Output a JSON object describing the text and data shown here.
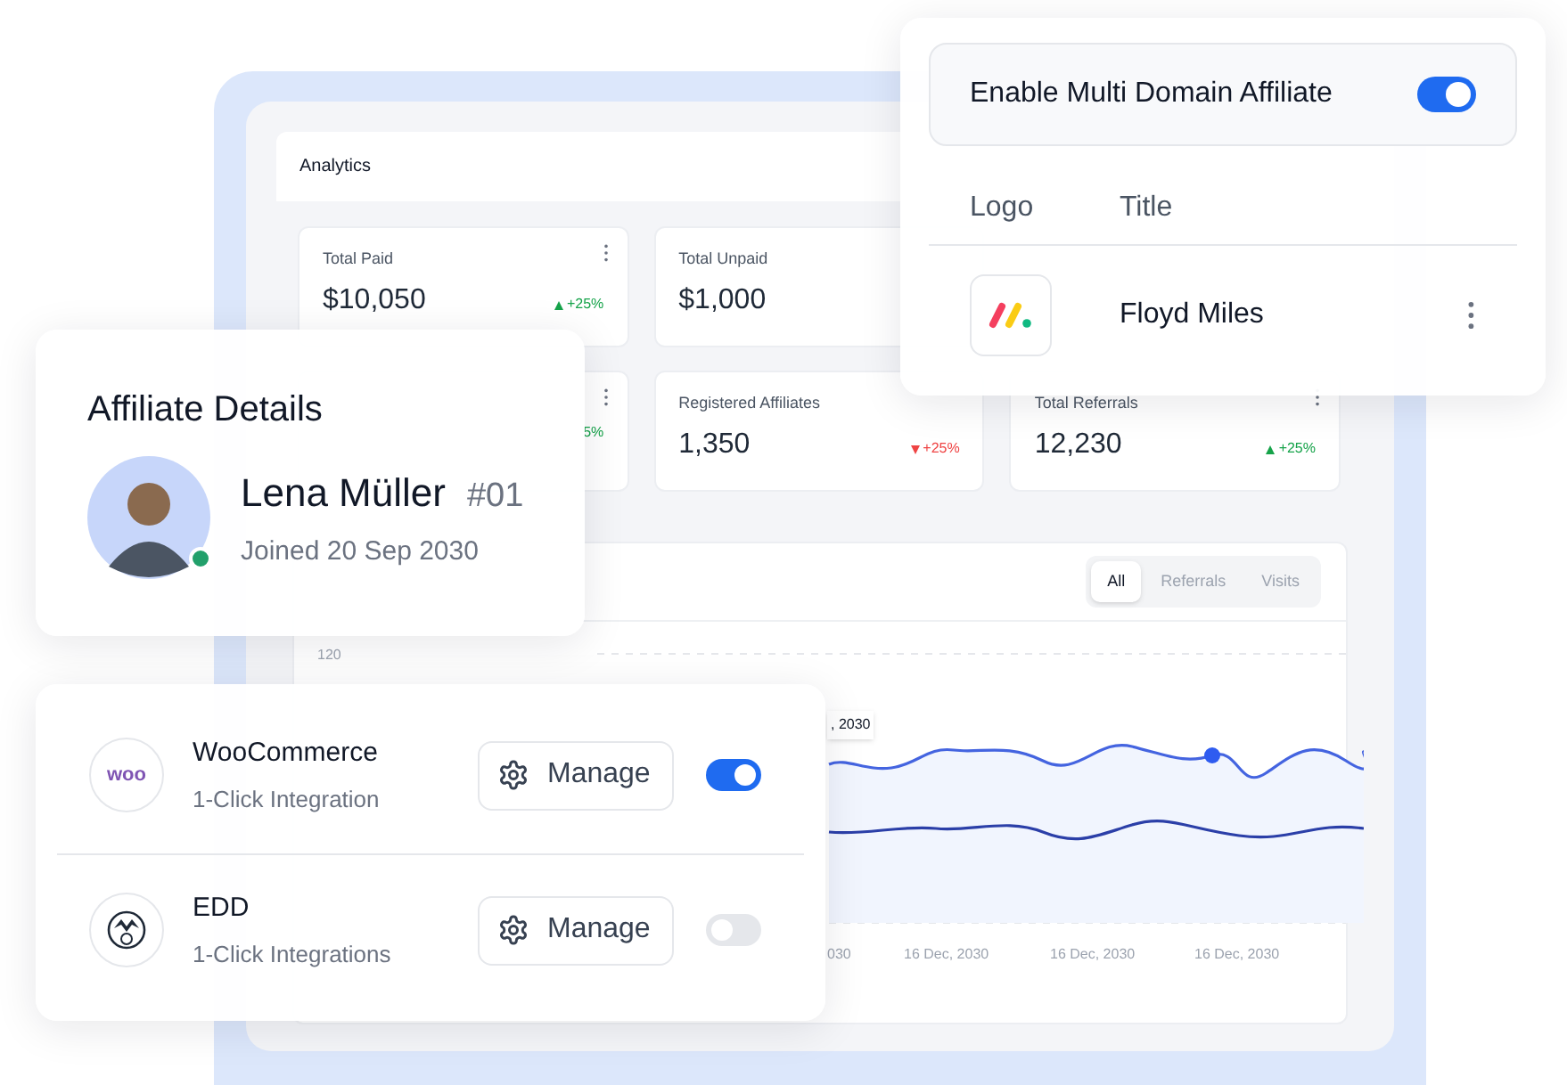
{
  "analytics": {
    "title": "Analytics",
    "stats": [
      {
        "label": "Total Paid",
        "value": "$10,050",
        "trend": "+25%",
        "trend_up": true,
        "menu": true
      },
      {
        "label": "Total Unpaid",
        "value": "$1,000"
      },
      {
        "trend": "5%",
        "menu": true
      },
      {
        "label": "Registered Affiliates",
        "value": "1,350",
        "trend": "+25%",
        "trend_up": false
      },
      {
        "label": "Total Referrals",
        "value": "12,230",
        "trend": "+25%",
        "trend_up": true,
        "menu": true
      }
    ],
    "tabs": [
      {
        "label": "All",
        "selected": true
      },
      {
        "label": "Referrals",
        "selected": false
      },
      {
        "label": "Visits",
        "selected": false
      }
    ],
    "y_tick": "120",
    "tooltip": ", 2030",
    "x_labels": [
      "030",
      "16 Dec, 2030",
      "16 Dec, 2030",
      "16 Dec, 2030"
    ]
  },
  "multi_domain": {
    "label": "Enable Multi Domain Affiliate",
    "on": true,
    "columns": [
      "Logo",
      "Title"
    ],
    "rows": [
      {
        "title": "Floyd Miles"
      }
    ]
  },
  "affiliate": {
    "heading": "Affiliate Details",
    "name": "Lena Müller",
    "number": "#01",
    "joined": "Joined 20 Sep 2030",
    "online": true
  },
  "integrations": [
    {
      "kind": "woo",
      "logo_text": "woo",
      "name": "WooCommerce",
      "subtitle": "1-Click Integration",
      "button": "Manage",
      "on": true
    },
    {
      "kind": "edd",
      "name": "EDD",
      "subtitle": "1-Click Integrations",
      "button": "Manage",
      "on": false
    }
  ]
}
